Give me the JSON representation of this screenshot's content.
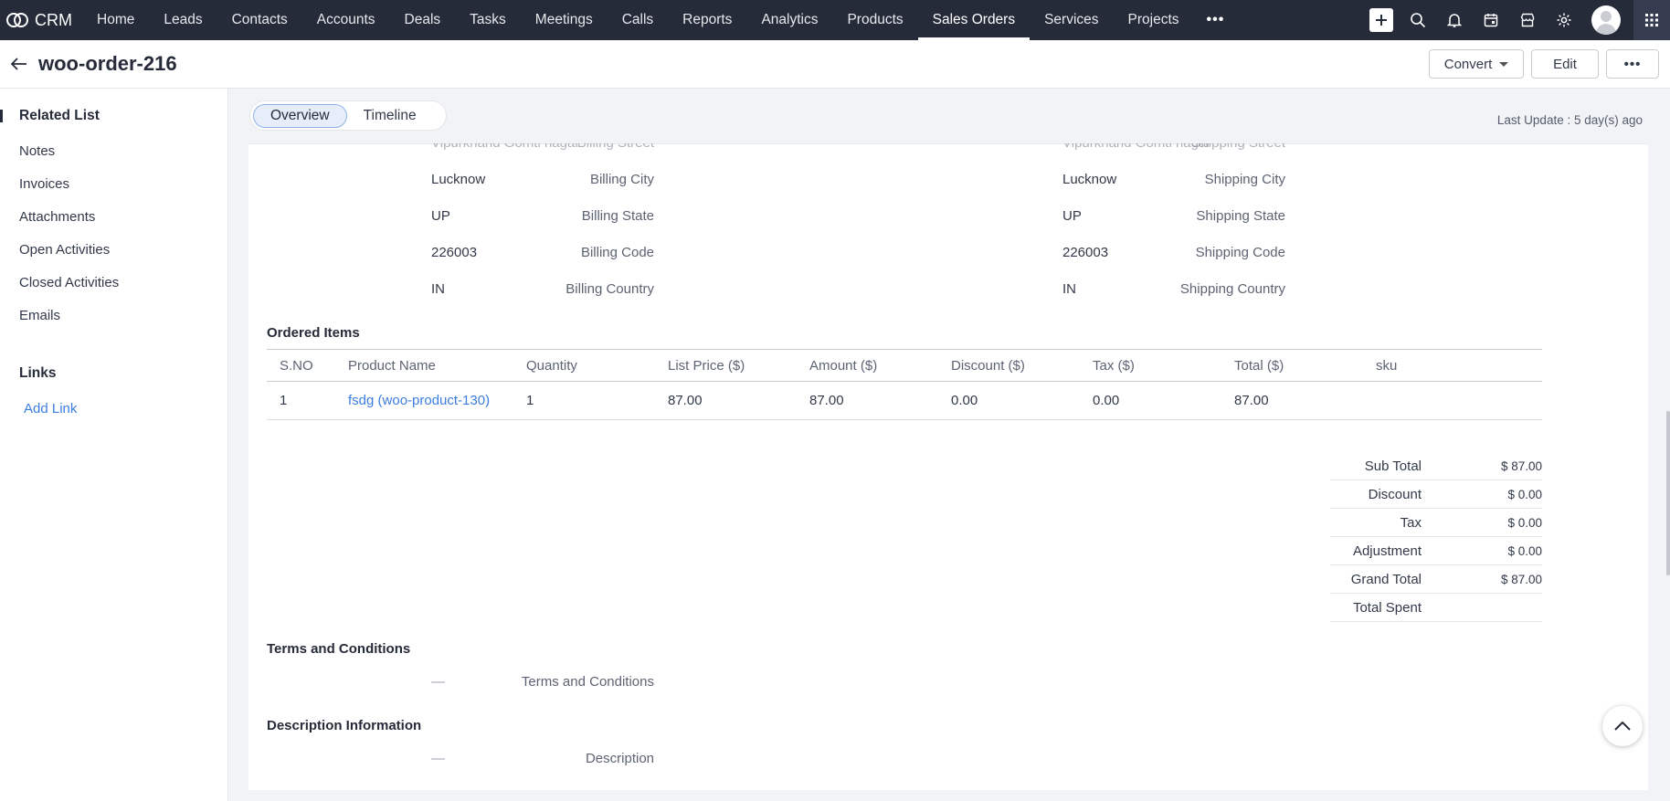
{
  "app": {
    "brand": "CRM"
  },
  "nav": {
    "items": [
      "Home",
      "Leads",
      "Contacts",
      "Accounts",
      "Deals",
      "Tasks",
      "Meetings",
      "Calls",
      "Reports",
      "Analytics",
      "Products",
      "Sales Orders",
      "Services",
      "Projects"
    ],
    "active": "Sales Orders",
    "more_label": "•••"
  },
  "record": {
    "title": "woo-order-216",
    "convert_label": "Convert",
    "edit_label": "Edit",
    "more_label": "•••"
  },
  "sidebar": {
    "related_title": "Related List",
    "related_items": [
      "Notes",
      "Invoices",
      "Attachments",
      "Open Activities",
      "Closed Activities",
      "Emails"
    ],
    "links_title": "Links",
    "add_link_label": "Add Link"
  },
  "tabs": {
    "overview": "Overview",
    "timeline": "Timeline"
  },
  "last_update": "Last Update : 5 day(s) ago",
  "address": {
    "billing": [
      {
        "label": "Billing Street",
        "value": "Vipurkhand Gomti nagar"
      },
      {
        "label": "Billing City",
        "value": "Lucknow"
      },
      {
        "label": "Billing State",
        "value": "UP"
      },
      {
        "label": "Billing Code",
        "value": "226003"
      },
      {
        "label": "Billing Country",
        "value": "IN"
      }
    ],
    "shipping": [
      {
        "label": "Shipping Street",
        "value": "Vipurkhand Gomti nagar"
      },
      {
        "label": "Shipping City",
        "value": "Lucknow"
      },
      {
        "label": "Shipping State",
        "value": "UP"
      },
      {
        "label": "Shipping Code",
        "value": "226003"
      },
      {
        "label": "Shipping Country",
        "value": "IN"
      }
    ]
  },
  "ordered_items": {
    "title": "Ordered Items",
    "columns": [
      "S.NO",
      "Product Name",
      "Quantity",
      "List Price ($)",
      "Amount ($)",
      "Discount ($)",
      "Tax ($)",
      "Total ($)",
      "sku"
    ],
    "rows": [
      {
        "sno": "1",
        "product": "fsdg (woo-product-130)",
        "quantity": "1",
        "list_price": "87.00",
        "amount": "87.00",
        "discount": "0.00",
        "tax": "0.00",
        "total": "87.00",
        "sku": ""
      }
    ]
  },
  "totals": [
    {
      "label": "Sub Total",
      "value": "$ 87.00"
    },
    {
      "label": "Discount",
      "value": "$ 0.00"
    },
    {
      "label": "Tax",
      "value": "$ 0.00"
    },
    {
      "label": "Adjustment",
      "value": "$ 0.00"
    },
    {
      "label": "Grand Total",
      "value": "$ 87.00"
    },
    {
      "label": "Total Spent",
      "value": ""
    }
  ],
  "terms": {
    "title": "Terms and Conditions",
    "label": "Terms and Conditions",
    "value": "—"
  },
  "description": {
    "title": "Description Information",
    "label": "Description",
    "value": "—"
  },
  "colors": {
    "nav_bg": "#262b3a",
    "link": "#3b7de0",
    "page_bg": "#f1f3f6"
  }
}
